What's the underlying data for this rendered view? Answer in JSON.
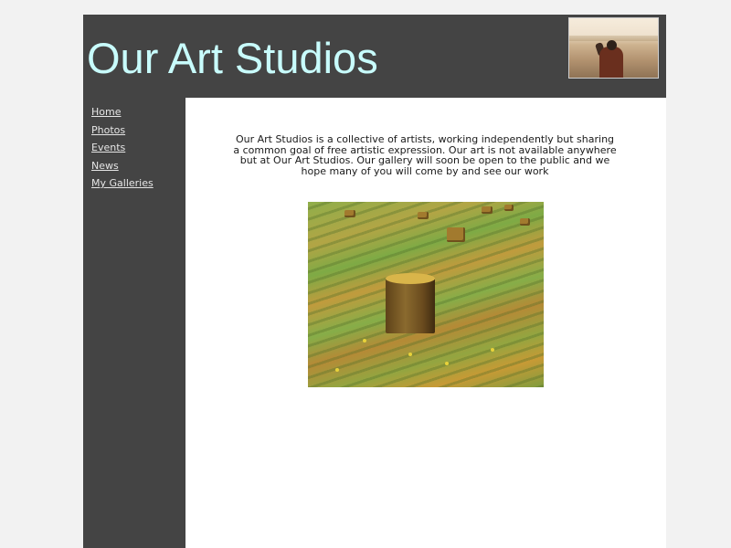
{
  "header": {
    "title": "Our Art Studios",
    "photo_icon": "photo-of-person-on-beach"
  },
  "nav": {
    "items": [
      {
        "label": "Home"
      },
      {
        "label": "Photos"
      },
      {
        "label": "Events"
      },
      {
        "label": "News"
      },
      {
        "label": "My Galleries"
      }
    ]
  },
  "main": {
    "intro": "Our Art Studios is a collective of artists, working independently but sharing a common goal of free artistic expression. Our art is not available anywhere but at Our Art Studios. Our gallery will soon be open to the public and we hope many of you will come by and see our work",
    "painting_icon": "painting-of-field-with-hay-bales"
  },
  "colors": {
    "page_bg": "#f2f2f2",
    "panel_bg": "#444444",
    "title_color": "#c8fcfc",
    "content_bg": "#ffffff"
  }
}
